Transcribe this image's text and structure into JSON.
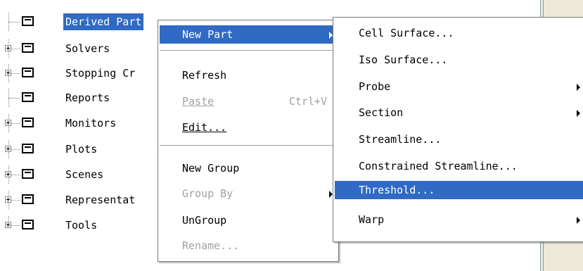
{
  "tree": {
    "items": [
      {
        "label": "Derived Part",
        "expandable": false,
        "selected": true
      },
      {
        "label": "Solvers",
        "expandable": true,
        "selected": false
      },
      {
        "label": "Stopping Cr",
        "expandable": true,
        "selected": false
      },
      {
        "label": "Reports",
        "expandable": false,
        "selected": false
      },
      {
        "label": "Monitors",
        "expandable": true,
        "selected": false
      },
      {
        "label": "Plots",
        "expandable": true,
        "selected": false
      },
      {
        "label": "Scenes",
        "expandable": true,
        "selected": false
      },
      {
        "label": "Representat",
        "expandable": true,
        "selected": false
      },
      {
        "label": "Tools",
        "expandable": true,
        "selected": false
      }
    ]
  },
  "context_menu": {
    "new_part": "New Part",
    "refresh": "Refresh",
    "paste": "Paste",
    "paste_shortcut": "Ctrl+V",
    "edit": "Edit...",
    "new_group": "New Group",
    "group_by": "Group By",
    "ungroup": "UnGroup",
    "rename": "Rename..."
  },
  "submenu": {
    "cell_surface": "Cell Surface...",
    "iso_surface": "Iso Surface...",
    "probe": "Probe",
    "section": "Section",
    "streamline": "Streamline...",
    "constrained_streamline": "Constrained Streamline...",
    "threshold": "Threshold...",
    "warp": "Warp"
  },
  "colors": {
    "highlight": "#316ac5",
    "disabled_text": "#a0a0a0",
    "panel_bg": "#ece9d8"
  }
}
